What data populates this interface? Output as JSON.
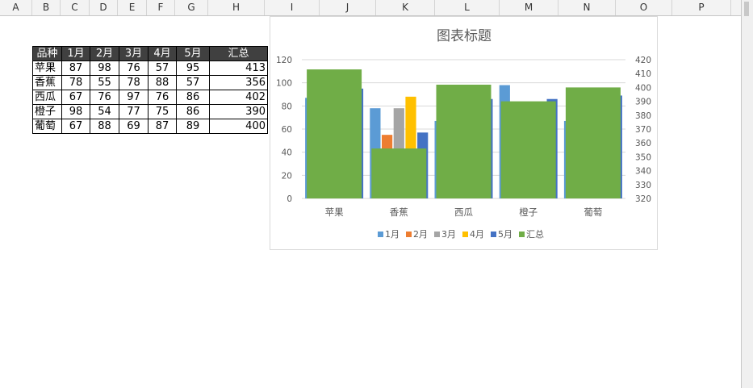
{
  "spreadsheet": {
    "column_headers": [
      "A",
      "B",
      "C",
      "D",
      "E",
      "F",
      "G",
      "H",
      "I",
      "J",
      "K",
      "L",
      "M",
      "N",
      "O",
      "P"
    ],
    "table": {
      "headers": [
        "品种",
        "1月",
        "2月",
        "3月",
        "4月",
        "5月",
        "汇总"
      ],
      "rows": [
        [
          "苹果",
          "87",
          "98",
          "76",
          "57",
          "95",
          "413"
        ],
        [
          "香蕉",
          "78",
          "55",
          "78",
          "88",
          "57",
          "356"
        ],
        [
          "西瓜",
          "67",
          "76",
          "97",
          "76",
          "86",
          "402"
        ],
        [
          "橙子",
          "98",
          "54",
          "77",
          "75",
          "86",
          "390"
        ],
        [
          "葡萄",
          "67",
          "88",
          "69",
          "87",
          "89",
          "400"
        ]
      ]
    }
  },
  "chart_data": {
    "type": "bar",
    "title": "图表标题",
    "categories": [
      "苹果",
      "香蕉",
      "西瓜",
      "橙子",
      "葡萄"
    ],
    "series": [
      {
        "name": "1月",
        "axis": "primary",
        "color": "#5b9bd5",
        "values": [
          87,
          78,
          67,
          98,
          67
        ]
      },
      {
        "name": "2月",
        "axis": "primary",
        "color": "#ed7d31",
        "values": [
          98,
          55,
          76,
          54,
          88
        ]
      },
      {
        "name": "3月",
        "axis": "primary",
        "color": "#a5a5a5",
        "values": [
          76,
          78,
          97,
          77,
          69
        ]
      },
      {
        "name": "4月",
        "axis": "primary",
        "color": "#ffc000",
        "values": [
          57,
          88,
          76,
          75,
          87
        ]
      },
      {
        "name": "5月",
        "axis": "primary",
        "color": "#4472c4",
        "values": [
          95,
          57,
          86,
          86,
          89
        ]
      },
      {
        "name": "汇总",
        "axis": "secondary",
        "color": "#70ad47",
        "values": [
          413,
          356,
          402,
          390,
          400
        ]
      }
    ],
    "y_primary": {
      "min": 0,
      "max": 120,
      "ticks": [
        0,
        20,
        40,
        60,
        80,
        100,
        120
      ]
    },
    "y_secondary": {
      "min": 320,
      "max": 420,
      "ticks": [
        320,
        330,
        340,
        350,
        360,
        370,
        380,
        390,
        400,
        410,
        420
      ]
    },
    "legend_position": "bottom",
    "grid": true
  }
}
